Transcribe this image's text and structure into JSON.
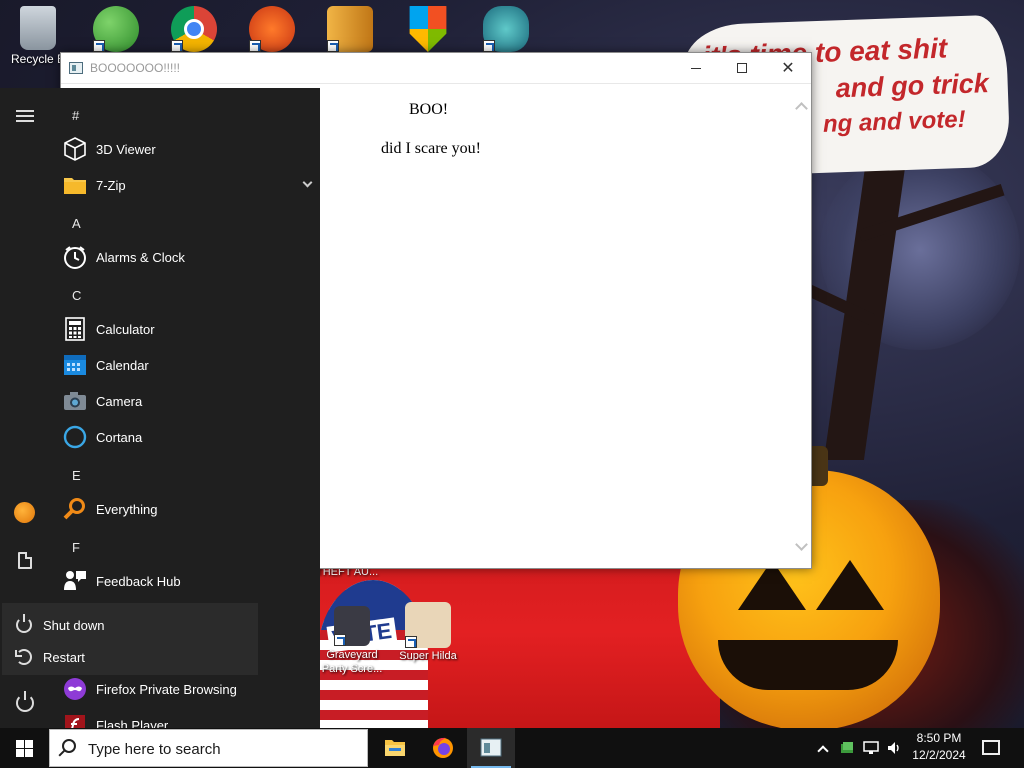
{
  "desktop": {
    "speech_bubble": {
      "line1": "it's time to eat shit",
      "line2": "and go trick",
      "line3": "ng and vote!"
    },
    "icons": [
      {
        "name": "recycle-bin",
        "label": "Recycle B"
      },
      {
        "name": "graveyard-party",
        "label": "Graveyard Party Scre..."
      },
      {
        "name": "super-hilda",
        "label": "Super Hilda"
      },
      {
        "name": "theft-auto",
        "label": "THEFT AU..."
      }
    ]
  },
  "window": {
    "title": "BOOOOOOO!!!!!",
    "heading": "BOO!",
    "body": "did I scare you!"
  },
  "start_menu": {
    "sections": [
      {
        "letter": "#",
        "items": [
          {
            "label": "3D Viewer",
            "icon": "cube-icon"
          },
          {
            "label": "7-Zip",
            "icon": "folder-icon",
            "expandable": true
          }
        ]
      },
      {
        "letter": "A",
        "items": [
          {
            "label": "Alarms & Clock",
            "icon": "clock-icon"
          }
        ]
      },
      {
        "letter": "C",
        "items": [
          {
            "label": "Calculator",
            "icon": "calculator-icon"
          },
          {
            "label": "Calendar",
            "icon": "calendar-icon"
          },
          {
            "label": "Camera",
            "icon": "camera-icon"
          },
          {
            "label": "Cortana",
            "icon": "cortana-icon"
          }
        ]
      },
      {
        "letter": "E",
        "items": [
          {
            "label": "Everything",
            "icon": "magnifier-icon"
          }
        ]
      },
      {
        "letter": "F",
        "items": [
          {
            "label": "Feedback Hub",
            "icon": "feedback-icon"
          },
          {
            "label": "Firefox Private Browsing",
            "icon": "firefox-private-icon"
          },
          {
            "label": "Flash Player",
            "icon": "flash-icon"
          }
        ]
      }
    ],
    "power_flyout": {
      "shutdown": "Shut down",
      "restart": "Restart"
    }
  },
  "taskbar": {
    "search_placeholder": "Type here to search",
    "time": "8:50 PM",
    "date": "12/2/2024"
  }
}
